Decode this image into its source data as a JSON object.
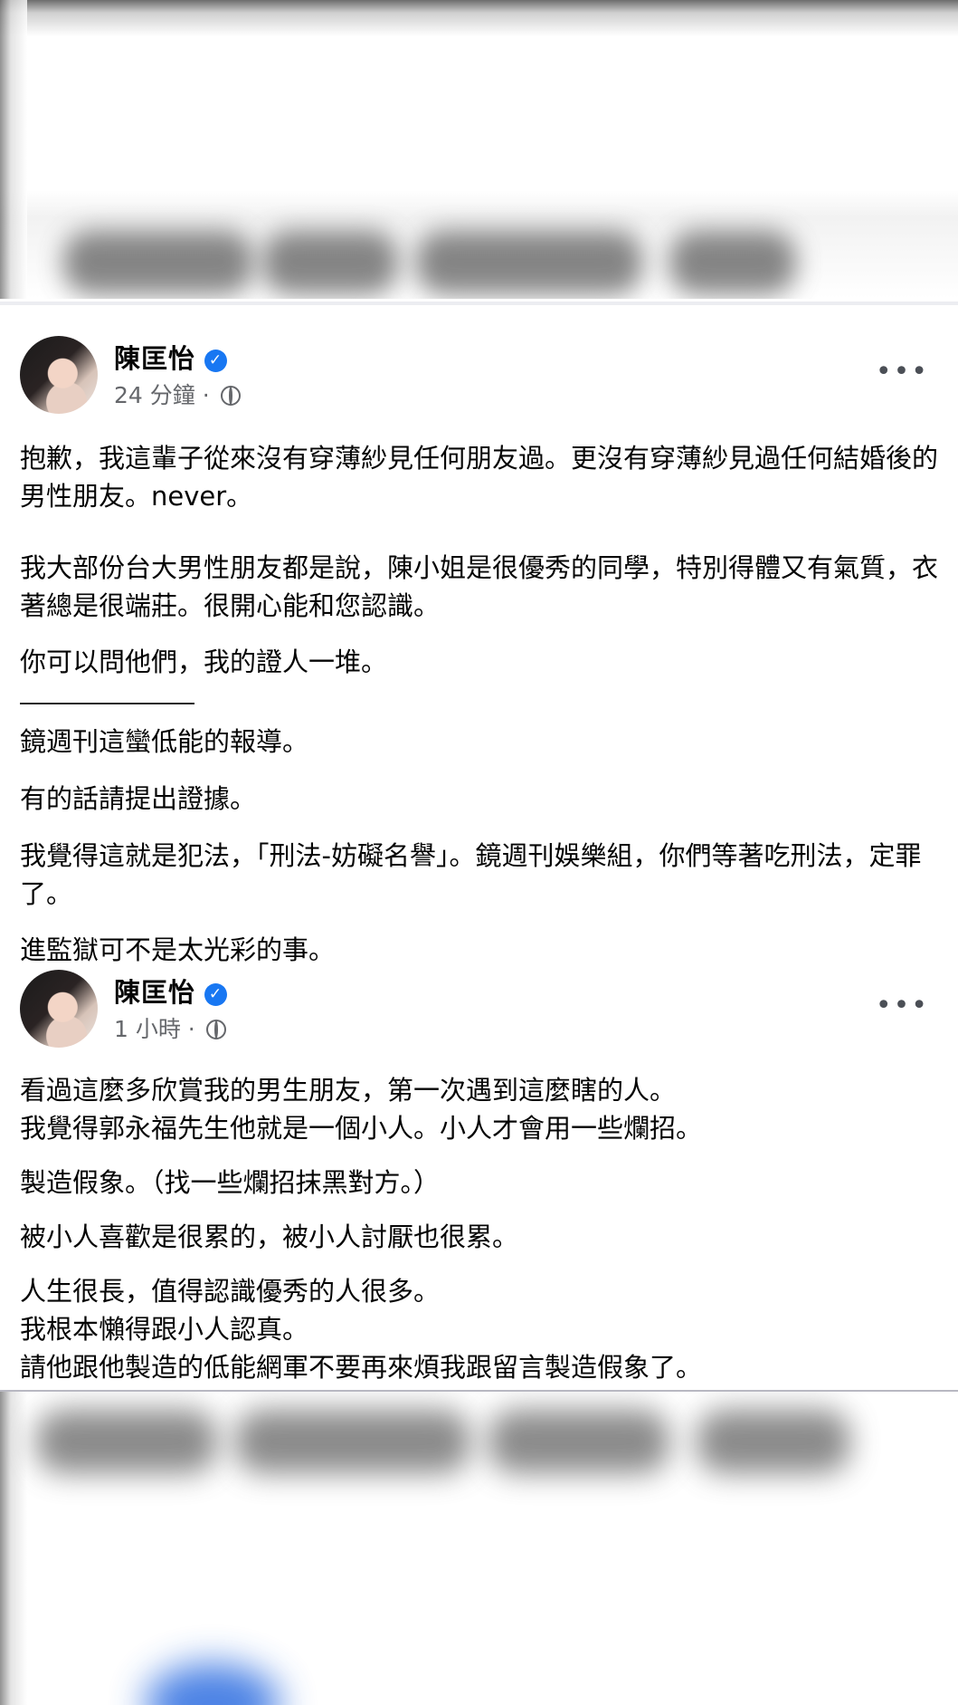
{
  "posts": [
    {
      "author": "陳匡怡",
      "time": "24 分鐘",
      "menu": "•••",
      "verified_mark": "✓",
      "paragraphs": [
        "抱歉，我這輩子從來沒有穿薄紗見任何朋友過。更沒有穿薄紗見過任何結婚後的男性朋友。never。",
        "我大部份台大男性朋友都是說，陳小姐是很優秀的同學，特別得體又有氣質，衣著總是很端莊。很開心能和您認識。",
        "你可以問他們，我的證人一堆。",
        "鏡週刊這蠻低能的報導。",
        "有的話請提出證據。",
        "我覺得這就是犯法，「刑法-妨礙名譽」。鏡週刊娛樂組，你們等著吃刑法，定罪了。",
        "進監獄可不是太光彩的事。"
      ]
    },
    {
      "author": "陳匡怡",
      "time": "1 小時",
      "menu": "•••",
      "verified_mark": "✓",
      "paragraphs": [
        "看過這麼多欣賞我的男生朋友，第一次遇到這麼瞎的人。",
        "我覺得郭永福先生他就是一個小人。小人才會用一些爛招。",
        "製造假象。（找一些爛招抹黑對方。）",
        "被小人喜歡是很累的，被小人討厭也很累。",
        "人生很長，值得認識優秀的人很多。",
        "我根本懶得跟小人認真。",
        "請他跟他製造的低能網軍不要再來煩我跟留言製造假象了。"
      ]
    }
  ],
  "colors": {
    "verified": "#1877f2",
    "meta_text": "#65676b",
    "body_text": "#050505"
  },
  "icons": [
    "verified-badge-icon",
    "globe-icon",
    "more-options-icon"
  ]
}
